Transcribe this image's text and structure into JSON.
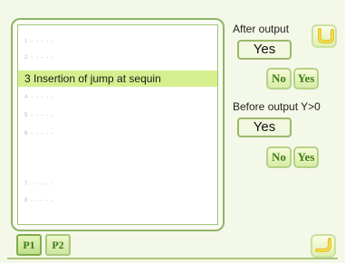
{
  "list": {
    "rows": [
      {
        "text": "1 - - - - -"
      },
      {
        "text": "2 - - - - -"
      },
      {
        "text": "3 Insertion of jump at sequin",
        "selected": true
      },
      {
        "text": "4 - - - - -"
      },
      {
        "text": "5 - - - - -"
      },
      {
        "text": "6 - - - - -"
      },
      {
        "text": "7 - - - - -"
      },
      {
        "text": "8 - - - - -"
      }
    ]
  },
  "after_output": {
    "label": "After output",
    "value": "Yes",
    "no_label": "No",
    "yes_label": "Yes"
  },
  "before_output": {
    "label": "Before output Y>0",
    "value": "Yes",
    "no_label": "No",
    "yes_label": "Yes"
  },
  "tabs": [
    {
      "label": "P1",
      "active": true
    },
    {
      "label": "P2",
      "active": false
    }
  ],
  "icons": {
    "top_right": "enter-arrow-icon",
    "bottom_right": "return-arrow-icon"
  },
  "colors": {
    "selected_row": "#d6ef8e",
    "accent_green": "#3f7d19",
    "border_green": "#8fb466"
  }
}
